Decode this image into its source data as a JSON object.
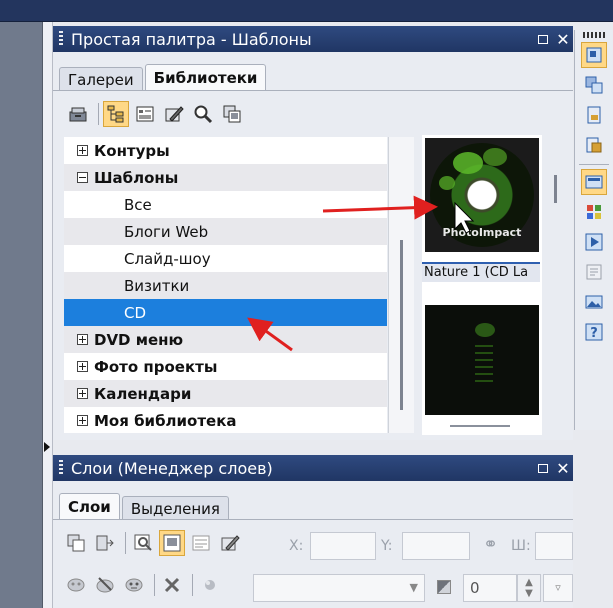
{
  "palette_panel": {
    "title": "Простая палитра - Шаблоны",
    "tabs": [
      {
        "label": "Галереи",
        "active": false
      },
      {
        "label": "Библиотеки",
        "active": true
      }
    ],
    "toolbar_icons": [
      "library-icon",
      "tree-view-icon",
      "list-view-icon",
      "edit-icon",
      "search-icon",
      "copy-icon"
    ],
    "tree": [
      {
        "label": "Контуры",
        "type": "folder",
        "expanded": false
      },
      {
        "label": "Шаблоны",
        "type": "folder",
        "expanded": true
      },
      {
        "label": "Все",
        "type": "child"
      },
      {
        "label": "Блоги Web",
        "type": "child"
      },
      {
        "label": "Слайд-шоу",
        "type": "child"
      },
      {
        "label": "Визитки",
        "type": "child"
      },
      {
        "label": "CD",
        "type": "child",
        "selected": true
      },
      {
        "label": "DVD меню",
        "type": "folder",
        "expanded": false
      },
      {
        "label": "Фото  проекты",
        "type": "folder",
        "expanded": false
      },
      {
        "label": "Календари",
        "type": "folder",
        "expanded": false
      },
      {
        "label": "Моя  библиотека",
        "type": "folder",
        "expanded": false
      }
    ],
    "preview": {
      "items": [
        {
          "label": "Nature 1 (CD La",
          "disc_text": "PhotoImpact"
        },
        {
          "label": "",
          "disc_text": ""
        }
      ]
    }
  },
  "layers_panel": {
    "title": "Слои (Менеджер слоев)",
    "tabs": [
      {
        "label": "Слои",
        "active": true
      },
      {
        "label": "Выделения",
        "active": false
      }
    ],
    "fields": {
      "x_label": "X:",
      "y_label": "Y:",
      "w_label": "Ш:",
      "opacity_value": "0"
    }
  },
  "colors": {
    "title_bar": "#203664",
    "selection": "#1c7fdd",
    "active_tool": "#ffd886",
    "arrow": "#e0201f"
  }
}
